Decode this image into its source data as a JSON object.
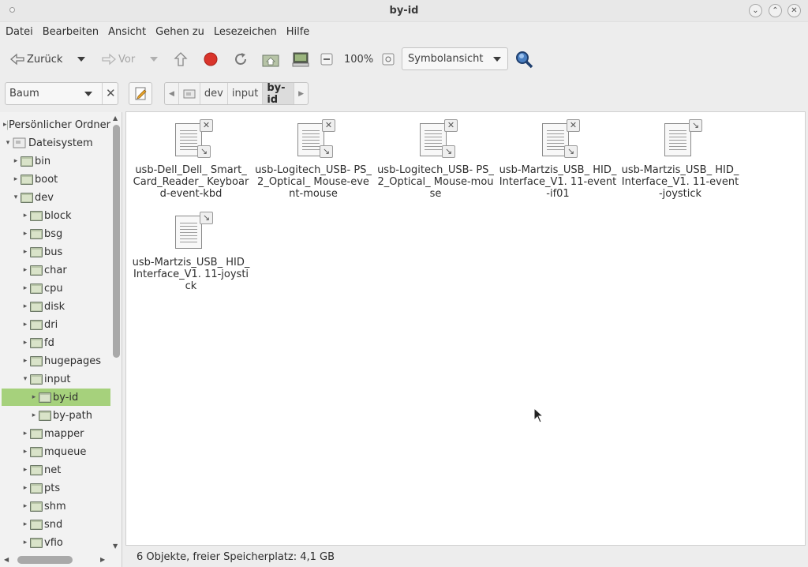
{
  "window": {
    "title": "by-id"
  },
  "menu": [
    "Datei",
    "Bearbeiten",
    "Ansicht",
    "Gehen zu",
    "Lesezeichen",
    "Hilfe"
  ],
  "toolbar": {
    "back_label": "Zurück",
    "forward_label": "Vor",
    "zoom": "100%",
    "view_mode": "Symbolansicht"
  },
  "sidebar_mode": "Baum",
  "path": [
    "dev",
    "input",
    "by-id"
  ],
  "tree": [
    {
      "label": "Persönlicher Ordner",
      "level": 0,
      "expanded": false,
      "icon": "home-folder-icon"
    },
    {
      "label": "Dateisystem",
      "level": 0,
      "expanded": true,
      "icon": "drive-icon"
    },
    {
      "label": "bin",
      "level": 1,
      "expanded": false
    },
    {
      "label": "boot",
      "level": 1,
      "expanded": false
    },
    {
      "label": "dev",
      "level": 1,
      "expanded": true
    },
    {
      "label": "block",
      "level": 2,
      "expanded": false
    },
    {
      "label": "bsg",
      "level": 2,
      "expanded": false
    },
    {
      "label": "bus",
      "level": 2,
      "expanded": false
    },
    {
      "label": "char",
      "level": 2,
      "expanded": false
    },
    {
      "label": "cpu",
      "level": 2,
      "expanded": false
    },
    {
      "label": "disk",
      "level": 2,
      "expanded": false
    },
    {
      "label": "dri",
      "level": 2,
      "expanded": false
    },
    {
      "label": "fd",
      "level": 2,
      "expanded": false
    },
    {
      "label": "hugepages",
      "level": 2,
      "expanded": false
    },
    {
      "label": "input",
      "level": 2,
      "expanded": true
    },
    {
      "label": "by-id",
      "level": 3,
      "expanded": false,
      "selected": true
    },
    {
      "label": "by-path",
      "level": 3,
      "expanded": false
    },
    {
      "label": "mapper",
      "level": 2,
      "expanded": false
    },
    {
      "label": "mqueue",
      "level": 2,
      "expanded": false
    },
    {
      "label": "net",
      "level": 2,
      "expanded": false
    },
    {
      "label": "pts",
      "level": 2,
      "expanded": false
    },
    {
      "label": "shm",
      "level": 2,
      "expanded": false
    },
    {
      "label": "snd",
      "level": 2,
      "expanded": false
    },
    {
      "label": "vfio",
      "level": 2,
      "expanded": false
    }
  ],
  "files": [
    {
      "name": "usb-Dell_Dell_ Smart_Card_Reader_ Keyboard-event-kbd",
      "broken": true
    },
    {
      "name": "usb-Logitech_USB- PS_2_Optical_ Mouse-event-mouse",
      "broken": true
    },
    {
      "name": "usb-Logitech_USB- PS_2_Optical_ Mouse-mouse",
      "broken": true
    },
    {
      "name": "usb-Martzis_USB_ HID_Interface_V1. 11-event-if01",
      "broken": true
    },
    {
      "name": "usb-Martzis_USB_ HID_Interface_V1. 11-event-joystick",
      "broken": false
    },
    {
      "name": "usb-Martzis_USB_ HID_Interface_V1. 11-joystick",
      "broken": false
    }
  ],
  "status": "6 Objekte, freier Speicherplatz: 4,1 GB",
  "colors": {
    "selection": "#a6d17c",
    "stop": "#d9342b"
  }
}
